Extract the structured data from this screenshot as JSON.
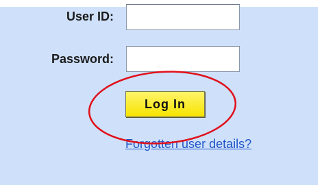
{
  "login_form": {
    "user_id_label": "User ID:",
    "user_id_value": "",
    "password_label": "Password:",
    "password_value": "",
    "login_button_label": "Log In",
    "forgot_link_label": "Forgotten user details?"
  },
  "colors": {
    "panel_background": "#cfe0fa",
    "button_fill": "#f6e400",
    "link": "#1e56c8",
    "highlight_ellipse": "#e0101a"
  }
}
